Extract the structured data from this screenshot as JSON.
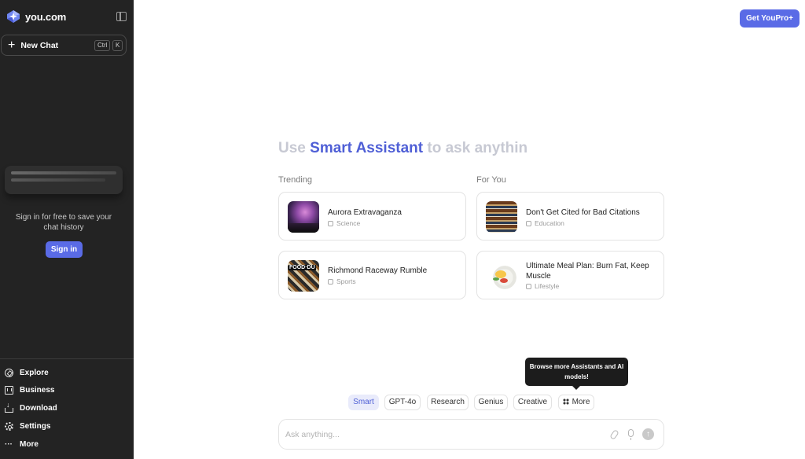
{
  "sidebar": {
    "logo_text": "you.com",
    "new_chat_label": "New Chat",
    "shortcut_ctrl": "Ctrl",
    "shortcut_key": "K",
    "signin_text": "Sign in for free to save your chat history",
    "signin_button": "Sign in",
    "nav": [
      {
        "label": "Explore",
        "icon": "compass-icon"
      },
      {
        "label": "Business",
        "icon": "building-icon"
      },
      {
        "label": "Download",
        "icon": "download-icon"
      },
      {
        "label": "Settings",
        "icon": "gear-icon"
      },
      {
        "label": "More",
        "icon": "ellipsis-icon"
      }
    ]
  },
  "header": {
    "pro_button": "Get YouPro+"
  },
  "headline": {
    "prefix": "Use ",
    "accent": "Smart Assistant",
    "suffix": " to ask anythin"
  },
  "trending": {
    "title": "Trending",
    "items": [
      {
        "title": "Aurora Extravaganza",
        "category": "Science"
      },
      {
        "title": "Richmond Raceway Rumble",
        "category": "Sports"
      }
    ]
  },
  "for_you": {
    "title": "For You",
    "items": [
      {
        "title": "Don't Get Cited for Bad Citations",
        "category": "Education"
      },
      {
        "title": "Ultimate Meal Plan: Burn Fat, Keep Muscle",
        "category": "Lifestyle"
      }
    ]
  },
  "tooltip": "Browse more Assistants and AI models!",
  "models": {
    "active": "Smart",
    "items": [
      "Smart",
      "GPT-4o",
      "Research",
      "Genius",
      "Creative",
      "More"
    ]
  },
  "ask": {
    "placeholder": "Ask anything...",
    "send_symbol": "↑"
  },
  "colors": {
    "accent": "#5a6be6",
    "sidebar_bg": "#232323"
  }
}
